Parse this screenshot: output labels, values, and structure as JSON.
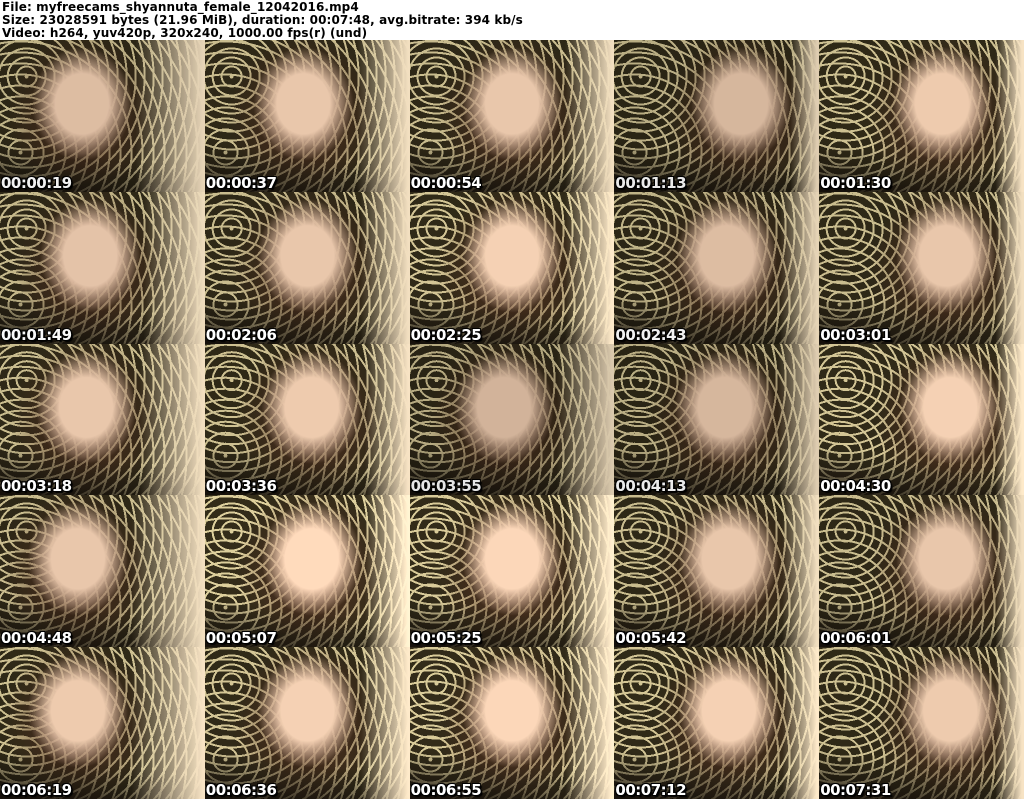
{
  "header": {
    "line1": "File: myfreecams_shyannuta_female_12042016.mp4",
    "line2": "Size: 23028591 bytes (21.96 MiB), duration: 00:07:48, avg.bitrate: 394 kb/s",
    "line3": "Video: h264, yuv420p, 320x240, 1000.00 fps(r) (und)"
  },
  "colors": {
    "header_bg": "#ffffff",
    "header_text": "#000000",
    "timestamp_text": "#ffffff",
    "timestamp_outline": "#000000",
    "frame_background_olive": "#2e2817",
    "frame_pattern_beige": "#c9bc8e",
    "frame_skin_warm": "#e9c7ab",
    "frame_hair_auburn": "#4e2b1d",
    "frame_light_right": "#f2dfc0",
    "frame_dark_bottom": "#140f0a"
  },
  "grid": {
    "columns": 5,
    "rows": 5,
    "thumbnails": [
      {
        "timestamp": "00:00:19",
        "fx": 40,
        "br": 0.95
      },
      {
        "timestamp": "00:00:37",
        "fx": 48,
        "br": 1.0
      },
      {
        "timestamp": "00:00:54",
        "fx": 50,
        "br": 1.0
      },
      {
        "timestamp": "00:01:13",
        "fx": 62,
        "br": 0.92
      },
      {
        "timestamp": "00:01:30",
        "fx": 60,
        "br": 1.02
      },
      {
        "timestamp": "00:01:49",
        "fx": 44,
        "br": 0.98
      },
      {
        "timestamp": "00:02:06",
        "fx": 50,
        "br": 1.0
      },
      {
        "timestamp": "00:02:25",
        "fx": 50,
        "br": 1.05
      },
      {
        "timestamp": "00:02:43",
        "fx": 55,
        "br": 0.95
      },
      {
        "timestamp": "00:03:01",
        "fx": 62,
        "br": 1.0
      },
      {
        "timestamp": "00:03:18",
        "fx": 42,
        "br": 1.0
      },
      {
        "timestamp": "00:03:36",
        "fx": 52,
        "br": 1.02
      },
      {
        "timestamp": "00:03:55",
        "fx": 46,
        "br": 0.9
      },
      {
        "timestamp": "00:04:13",
        "fx": 54,
        "br": 0.92
      },
      {
        "timestamp": "00:04:30",
        "fx": 64,
        "br": 1.05
      },
      {
        "timestamp": "00:04:48",
        "fx": 38,
        "br": 1.0
      },
      {
        "timestamp": "00:05:07",
        "fx": 52,
        "br": 1.1
      },
      {
        "timestamp": "00:05:25",
        "fx": 50,
        "br": 1.08
      },
      {
        "timestamp": "00:05:42",
        "fx": 56,
        "br": 1.0
      },
      {
        "timestamp": "00:06:01",
        "fx": 62,
        "br": 1.0
      },
      {
        "timestamp": "00:06:19",
        "fx": 38,
        "br": 1.02
      },
      {
        "timestamp": "00:06:36",
        "fx": 50,
        "br": 1.05
      },
      {
        "timestamp": "00:06:55",
        "fx": 50,
        "br": 1.08
      },
      {
        "timestamp": "00:07:12",
        "fx": 56,
        "br": 1.05
      },
      {
        "timestamp": "00:07:31",
        "fx": 64,
        "br": 1.02
      }
    ]
  }
}
